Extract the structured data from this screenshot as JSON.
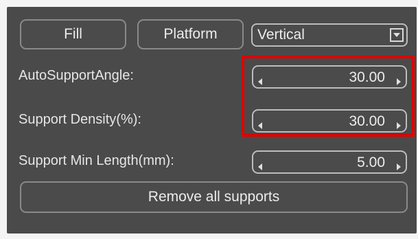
{
  "toolbar": {
    "fill_label": "Fill",
    "platform_label": "Platform"
  },
  "orientation": {
    "selected": "Vertical"
  },
  "settings": [
    {
      "label": "AutoSupportAngle:",
      "value": "30.00"
    },
    {
      "label": "Support Density(%):",
      "value": "30.00"
    },
    {
      "label": "Support Min Length(mm):",
      "value": "5.00"
    }
  ],
  "remove_label": "Remove all supports",
  "colors": {
    "panel_bg": "#4a4a4a",
    "highlight": "#e00000",
    "text": "#e8e8e8"
  },
  "icons": [
    "dropdown-arrow-icon",
    "decrement-arrow-icon",
    "increment-arrow-icon"
  ]
}
